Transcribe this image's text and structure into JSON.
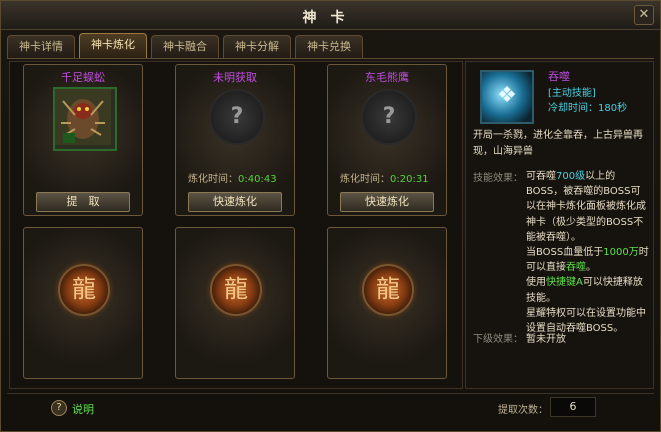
{
  "window": {
    "title": "神卡",
    "close_label": "✕"
  },
  "tabs": [
    {
      "label": "神卡详情",
      "active": false
    },
    {
      "label": "神卡炼化",
      "active": true
    },
    {
      "label": "神卡融合",
      "active": false
    },
    {
      "label": "神卡分解",
      "active": false
    },
    {
      "label": "神卡兑换",
      "active": false
    }
  ],
  "slots": [
    {
      "name": "千足蜈蚣",
      "button": "提　取"
    },
    {
      "name": "未明获取",
      "timer_label": "炼化时间：",
      "timer_value": "0:40:43",
      "button": "快速炼化"
    },
    {
      "name": "东毛熊鹰",
      "timer_label": "炼化时间：",
      "timer_value": "0:20:31",
      "button": "快速炼化"
    }
  ],
  "empty_slot_glyph": "龍",
  "question_glyph": "?",
  "skill": {
    "name": "吞噬",
    "type": "[主动技能]",
    "cd_label": "冷却时间：",
    "cd_value": "180秒",
    "intro": "开局一杀戮，进化全靠吞，上古异兽再现，山海异兽",
    "effect_label": "技能效果：",
    "effect": {
      "p1a": "可吞噬",
      "p1b": "700级",
      "p1c": "以上的BOSS，被吞噬的BOSS可以在神卡炼化面板被炼化成神卡（极少类型的BOSS不能被吞噬）。",
      "p2a": "当BOSS血量低于",
      "p2b": "1000万",
      "p2c": "时可以直接",
      "p2d": "吞噬",
      "p2e": "。",
      "p3a": "使用",
      "p3b": "快捷键A",
      "p3c": "可以快捷释放技能。",
      "p4": "星耀特权可以在设置功能中设置自动吞噬BOSS。"
    },
    "next_label": "下级效果：",
    "next_value": "暂未开放"
  },
  "footer": {
    "help_icon": "?",
    "help_label": "说明",
    "count_label": "提取次数：",
    "count_value": "6"
  },
  "colors": {
    "accent_purple": "#c04de0",
    "accent_green": "#5ee04a",
    "accent_cyan": "#4ad0e0"
  }
}
